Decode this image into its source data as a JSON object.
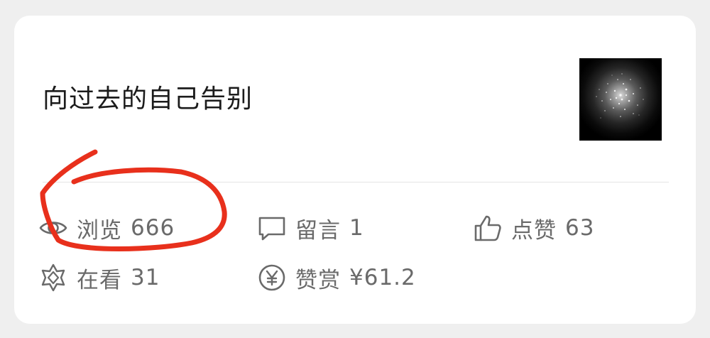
{
  "article": {
    "title": "向过去的自己告别"
  },
  "stats": {
    "views": {
      "label": "浏览",
      "value": "666"
    },
    "comments": {
      "label": "留言",
      "value": "1"
    },
    "likes": {
      "label": "点赞",
      "value": "63"
    },
    "wow": {
      "label": "在看",
      "value": "31"
    },
    "rewards": {
      "label": "赞赏",
      "value": "¥61.2"
    }
  },
  "colors": {
    "annotation": "#e8301c",
    "stat_text": "#6a6a6a",
    "title_text": "#1b1b1b"
  },
  "icons": {
    "views": "eye-icon",
    "comments": "comment-icon",
    "likes": "thumbs-up-icon",
    "wow": "star-flower-icon",
    "rewards": "yen-icon"
  }
}
